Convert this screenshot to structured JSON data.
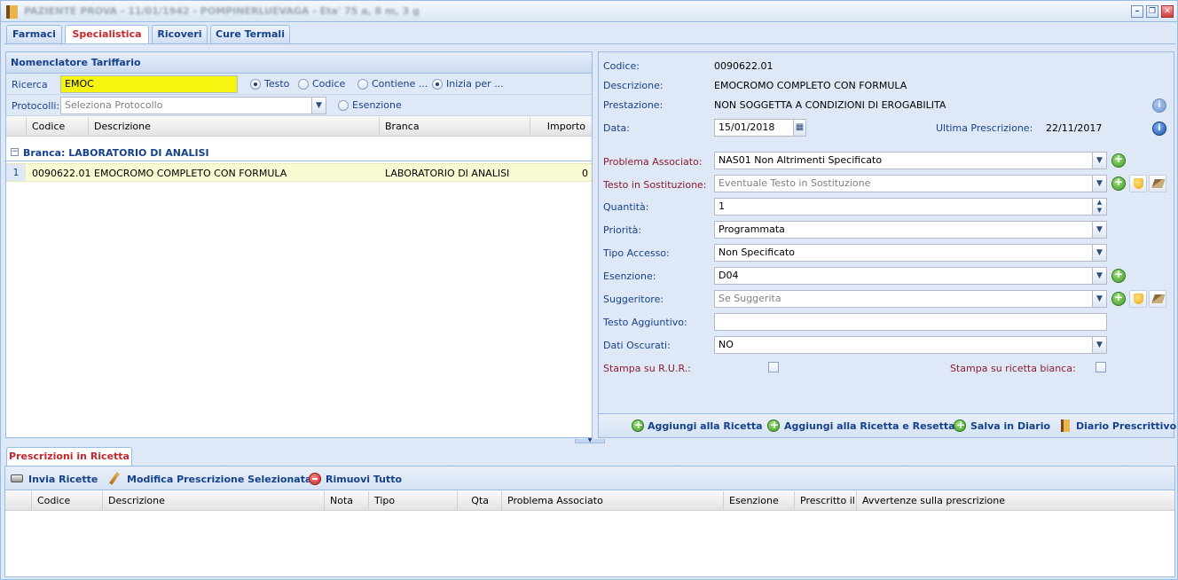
{
  "window": {
    "title": "PAZIENTE PROVA - 11/01/1942 - POMPINERLUEVAGA - Eta' 75 a, 8 m, 3 g"
  },
  "tabs": [
    "Farmaci",
    "Specialistica",
    "Ricoveri",
    "Cure Termali"
  ],
  "left": {
    "title": "Nomenclatore Tariffario",
    "search_label": "Ricerca",
    "search_value": "EMOC",
    "radio_testo": "Testo",
    "radio_codice": "Codice",
    "radio_contiene": "Contiene ...",
    "radio_inizia": "Inizia per ...",
    "protocolli_label": "Protocolli:",
    "protocolli_placeholder": "Seleziona Protocollo",
    "esenzione_label": "Esenzione",
    "columns": {
      "codice": "Codice",
      "descrizione": "Descrizione",
      "branca": "Branca",
      "importo": "Importo"
    },
    "group": "Branca: LABORATORIO DI ANALISI",
    "rows": [
      {
        "n": "1",
        "codice": "0090622.01",
        "descrizione": "EMOCROMO COMPLETO CON FORMULA",
        "branca": "LABORATORIO DI ANALISI",
        "importo": "0"
      }
    ]
  },
  "right": {
    "codice_label": "Codice:",
    "codice": "0090622.01",
    "descrizione_label": "Descrizione:",
    "descrizione": "EMOCROMO COMPLETO CON FORMULA",
    "prestazione_label": "Prestazione:",
    "prestazione": "NON SOGGETTA A CONDIZIONI DI EROGABILITA",
    "data_label": "Data:",
    "data": "15/01/2018",
    "ultima_label": "Ultima Prescrizione:",
    "ultima": "22/11/2017",
    "problema_label": "Problema Associato:",
    "problema": "NAS01 Non Altrimenti Specificato",
    "testo_sost_label": "Testo in Sostituzione:",
    "testo_sost_placeholder": "Eventuale Testo in Sostituzione",
    "quantita_label": "Quantità:",
    "quantita": "1",
    "priorita_label": "Priorità:",
    "priorita": "Programmata",
    "tipo_accesso_label": "Tipo Accesso:",
    "tipo_accesso": "Non Specificato",
    "esenzione_label": "Esenzione:",
    "esenzione": "D04",
    "suggeritore_label": "Suggeritore:",
    "suggeritore_placeholder": "Se Suggerita",
    "testo_agg_label": "Testo Aggiuntivo:",
    "testo_agg": "",
    "dati_osc_label": "Dati Oscurati:",
    "dati_osc": "NO",
    "stampa_rur_label": "Stampa su R.U.R.:",
    "stampa_bianca_label": "Stampa su ricetta bianca:",
    "btn_aggiungi": "Aggiungi alla Ricetta",
    "btn_aggiungi_reset": "Aggiungi alla Ricetta e Resetta",
    "btn_salva": "Salva in Diario",
    "btn_diario": "Diario Prescrittivo"
  },
  "bottom": {
    "tab": "Prescrizioni in Ricetta",
    "btn_invia": "Invia Ricette",
    "btn_modifica": "Modifica Prescrizione Selezionata",
    "btn_rimuovi": "Rimuovi Tutto",
    "columns": [
      "Codice",
      "Descrizione",
      "Nota",
      "Tipo",
      "Qta",
      "Problema Associato",
      "Esenzione",
      "Prescritto il",
      "Avvertenze sulla prescrizione"
    ]
  }
}
